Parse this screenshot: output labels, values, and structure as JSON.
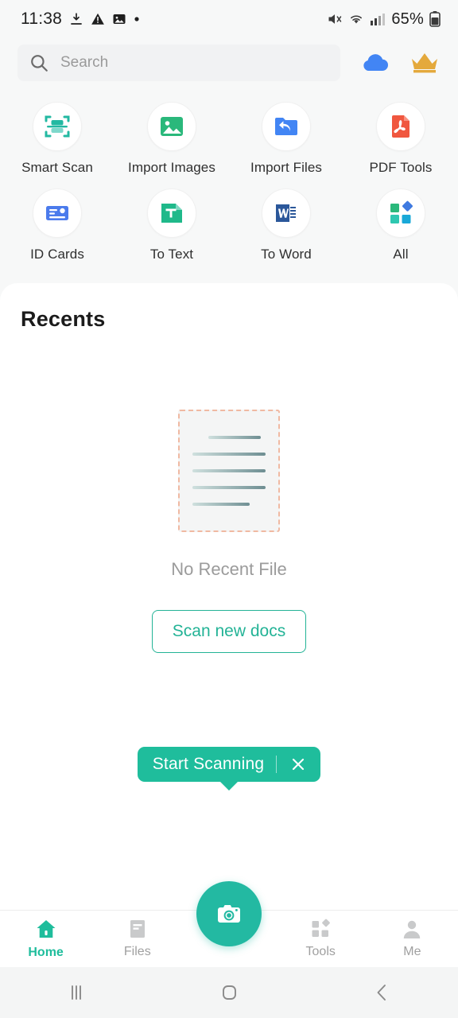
{
  "statusbar": {
    "time": "11:38",
    "battery": "65%",
    "left_icons": [
      "download-icon",
      "warning-triangle-icon",
      "image-icon",
      "dot-icon"
    ],
    "right_icons": [
      "mute-icon",
      "wifi-icon",
      "cellular-signal-icon",
      "battery-icon"
    ]
  },
  "header": {
    "search_placeholder": "Search",
    "search_value": "",
    "search_icon": "search-icon",
    "cloud_icon": "cloud-icon",
    "crown_icon": "crown-icon",
    "cloud_color": "#4285f4",
    "crown_color": "#e4a93c"
  },
  "shortcuts": [
    {
      "label": "Smart Scan",
      "icon": "smart-scan-icon",
      "color": "#23b9a2"
    },
    {
      "label": "Import Images",
      "icon": "import-images-icon",
      "color": "#2ab87b"
    },
    {
      "label": "Import Files",
      "icon": "import-files-icon",
      "color": "#4285f4"
    },
    {
      "label": "PDF Tools",
      "icon": "pdf-tools-icon",
      "color": "#f0573f"
    },
    {
      "label": "ID Cards",
      "icon": "id-cards-icon",
      "color": "#4b7bec"
    },
    {
      "label": "To Text",
      "icon": "to-text-icon",
      "color": "#1fb98a"
    },
    {
      "label": "To Word",
      "icon": "to-word-icon",
      "color": "#2b579a"
    },
    {
      "label": "All",
      "icon": "all-tools-icon",
      "color": "#2ab87b"
    }
  ],
  "recents": {
    "title": "Recents",
    "empty_text": "No Recent File",
    "scan_button": "Scan new docs",
    "illustration": "empty-document-illustration"
  },
  "tooltip": {
    "text": "Start Scanning",
    "close_icon": "close-icon",
    "background": "#1fbd9c"
  },
  "bottomnav": {
    "items": [
      {
        "label": "Home",
        "icon": "home-icon",
        "active": true
      },
      {
        "label": "Files",
        "icon": "files-icon",
        "active": false
      },
      {
        "label": "Tools",
        "icon": "tools-icon",
        "active": false
      },
      {
        "label": "Me",
        "icon": "profile-icon",
        "active": false
      }
    ],
    "fab_icon": "camera-icon",
    "accent": "#1fbd9c"
  },
  "androidnav": {
    "recents_icon": "recents-icon",
    "home_icon": "home-pill-icon",
    "back_icon": "back-chevron-icon"
  }
}
